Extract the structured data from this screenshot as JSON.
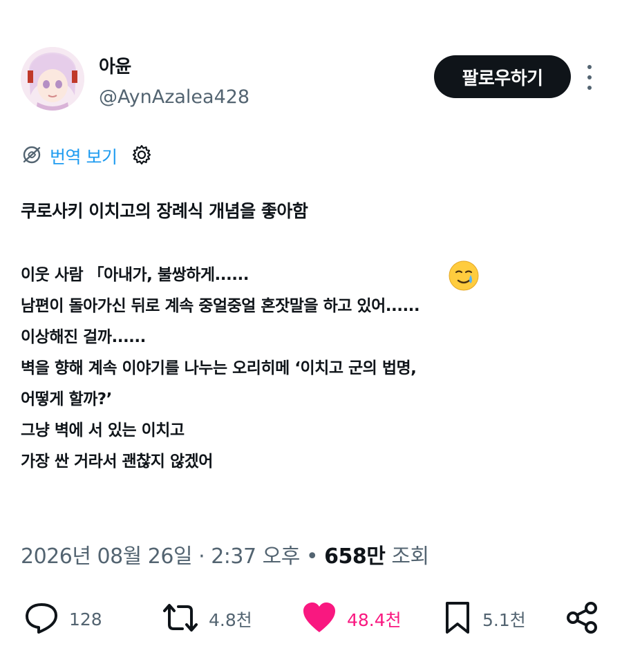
{
  "author": {
    "display_name": "아윤",
    "handle": "@AynAzalea428"
  },
  "follow_button": "팔로우하기",
  "translate": {
    "label": "번역 보기"
  },
  "post": {
    "title": "쿠로사키 이치고의 장례식 개념을 좋아함",
    "lines": [
      "이웃 사람 「아내가, 불쌍하게......",
      "남편이 돌아가신 뒤로 계속 중얼중얼 혼잣말을 하고 있어......",
      "이상해진 걸까......",
      "벽을 향해 계속 이야기를 나누는 오리히메 ‘이치고 군의 법명,",
      "어떻게 할까?’",
      "그냥 벽에 서 있는 이치고",
      "가장 싼 거라서 괜찮지 않겠어"
    ],
    "emoji": "face-holding-back-tears"
  },
  "meta": {
    "date": "2026년 08월 26일",
    "separator": "·",
    "time": "2:37 오후",
    "dot": "•",
    "views_count": "658만",
    "views_label": "조회"
  },
  "actions": {
    "replies": "128",
    "reposts": "4.8천",
    "likes": "48.4천",
    "bookmarks": "5.1천"
  },
  "colors": {
    "accent": "#1d9bf0",
    "like": "#f91880",
    "text": "#0f1419",
    "secondary": "#536471"
  }
}
